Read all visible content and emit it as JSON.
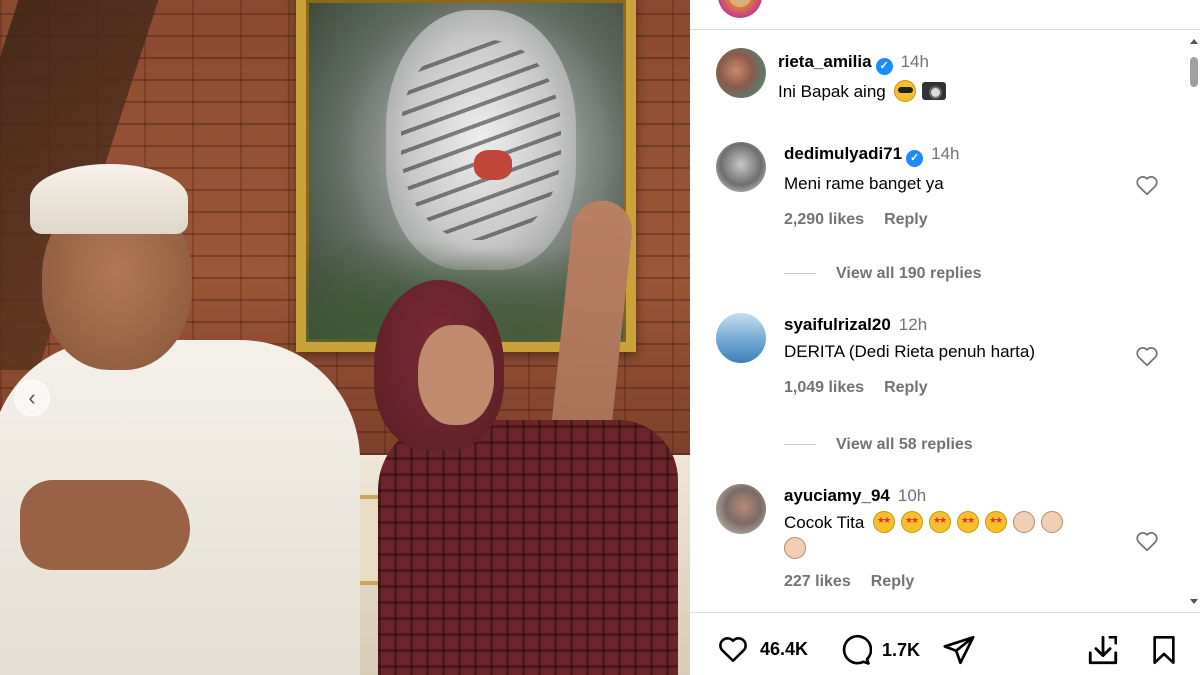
{
  "post": {
    "author_avatar": "avatar-ring"
  },
  "caption": {
    "username": "rieta_amilia",
    "verified": true,
    "time": "14h",
    "text": "Ini Bapak aing",
    "emojis": [
      "smiling-face-with-sunglasses",
      "camera-with-flash"
    ]
  },
  "comments": [
    {
      "username": "dedimulyadi71",
      "verified": true,
      "time": "14h",
      "text": "Meni rame banget ya",
      "likes": "2,290 likes",
      "reply_label": "Reply",
      "view_replies": "View all 190 replies"
    },
    {
      "username": "syaifulrizal20",
      "verified": false,
      "time": "12h",
      "text": "DERITA (Dedi Rieta penuh harta)",
      "likes": "1,049 likes",
      "reply_label": "Reply",
      "view_replies": "View all 58 replies"
    },
    {
      "username": "ayuciamy_94",
      "verified": false,
      "time": "10h",
      "text": "Cocok Tita",
      "emojis": [
        "star-struck",
        "star-struck",
        "star-struck",
        "star-struck",
        "star-struck",
        "palms-up-together",
        "palms-up-together",
        "palms-up-together"
      ],
      "likes": "227 likes",
      "reply_label": "Reply"
    }
  ],
  "actions": {
    "likes_count": "46.4K",
    "comments_count": "1.7K",
    "icons": [
      "heart-icon",
      "comment-icon",
      "share-icon",
      "save-to-device-icon",
      "bookmark-icon"
    ]
  },
  "colors": {
    "verified_blue": "#1a8cff",
    "secondary_text": "#737373",
    "divider": "#dbdbdb"
  }
}
